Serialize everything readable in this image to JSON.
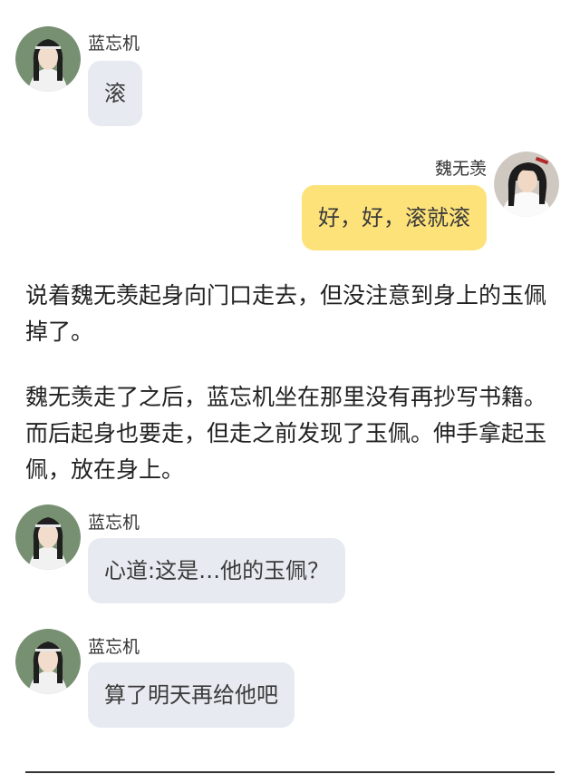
{
  "colors": {
    "background": "#ffffff",
    "left_bubble": "#e7ebf1",
    "right_bubble": "#fde27a",
    "text": "#222222"
  },
  "messages": [
    {
      "speaker": "蓝忘机",
      "side": "left",
      "text": "滚",
      "avatar_icon": "lan-wangji-avatar"
    },
    {
      "speaker": "魏无羡",
      "side": "right",
      "text": "好，好，滚就滚",
      "avatar_icon": "wei-wuxian-avatar"
    }
  ],
  "narration": [
    "说着魏无羡起身向门口走去，但没注意到身上的玉佩掉了。",
    "魏无羡走了之后，蓝忘机坐在那里没有再抄写书籍。而后起身也要走，但走之前发现了玉佩。伸手拿起玉佩，放在身上。"
  ],
  "messages_after": [
    {
      "speaker": "蓝忘机",
      "side": "left",
      "text": "心道:这是…他的玉佩？",
      "avatar_icon": "lan-wangji-avatar"
    },
    {
      "speaker": "蓝忘机",
      "side": "left",
      "text": "算了明天再给他吧",
      "avatar_icon": "lan-wangji-avatar"
    }
  ]
}
